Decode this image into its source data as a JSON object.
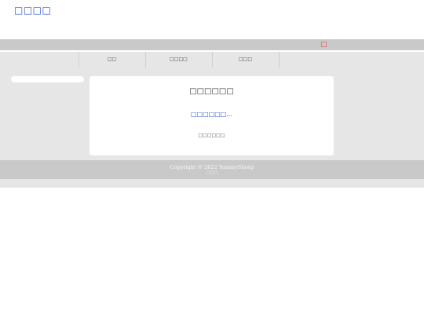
{
  "header": {
    "logo_text": "□□□□"
  },
  "user_bar": {
    "icon": "user-icon",
    "icon_glyph": "□",
    "accent": "#e04848"
  },
  "nav": {
    "items": [
      {
        "label": "□□"
      },
      {
        "label": "□□□□"
      },
      {
        "label": "□□□"
      }
    ]
  },
  "panel": {
    "title": "□□□□□□",
    "message": "□□□□□□...",
    "link": "□□□□□□"
  },
  "footer": {
    "copyright": "Copyright © 2022 YummySheep",
    "sub": "□□□"
  },
  "colors": {
    "brand": "#2a56c8",
    "bar": "#c9c9c9",
    "band": "#e6e6e6"
  }
}
